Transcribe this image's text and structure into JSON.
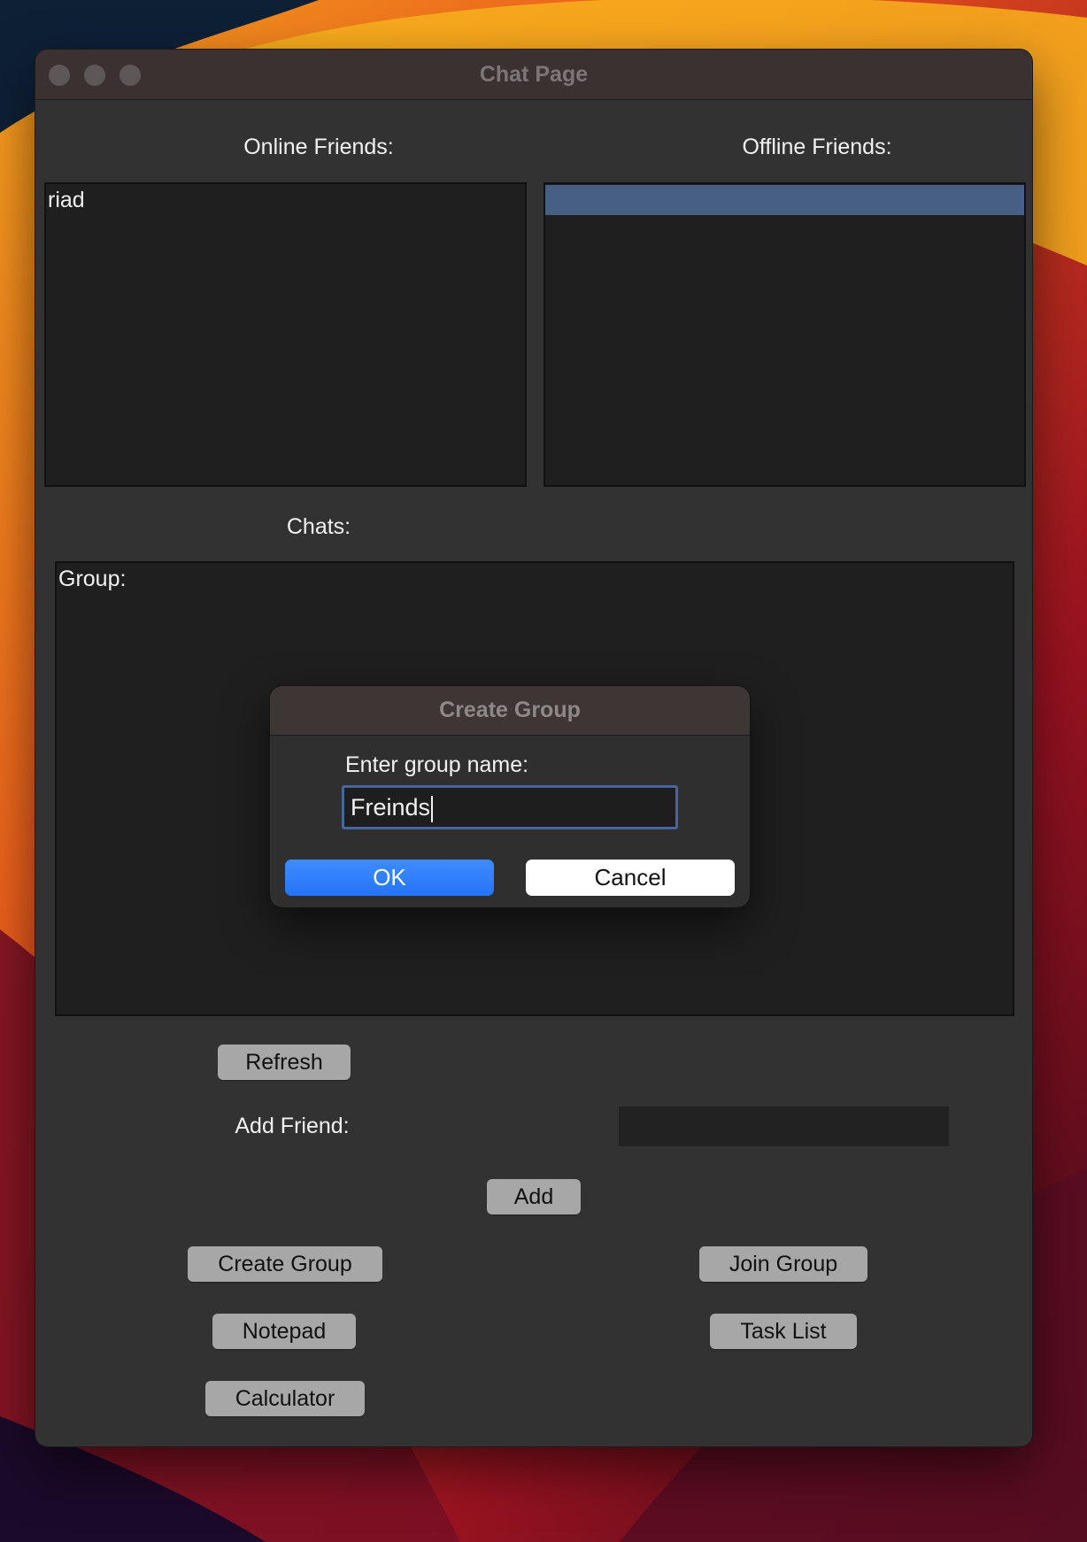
{
  "window": {
    "title": "Chat Page"
  },
  "online_friends": {
    "label": "Online Friends:",
    "items": [
      "riad"
    ]
  },
  "offline_friends": {
    "label": "Offline Friends:",
    "items": [
      ""
    ]
  },
  "chats": {
    "label": "Chats:",
    "content": "Group:"
  },
  "buttons": {
    "refresh": "Refresh",
    "add": "Add",
    "create_group": "Create Group",
    "join_group": "Join Group",
    "notepad": "Notepad",
    "task_list": "Task List",
    "calculator": "Calculator"
  },
  "add_friend": {
    "label": "Add Friend:",
    "value": ""
  },
  "dialog": {
    "title": "Create Group",
    "prompt": "Enter group name:",
    "input_value": "Freinds",
    "ok_label": "OK",
    "cancel_label": "Cancel"
  },
  "colors": {
    "selection": "#475e85",
    "primary_button": "#2f80ff",
    "window_bg": "#323232"
  }
}
